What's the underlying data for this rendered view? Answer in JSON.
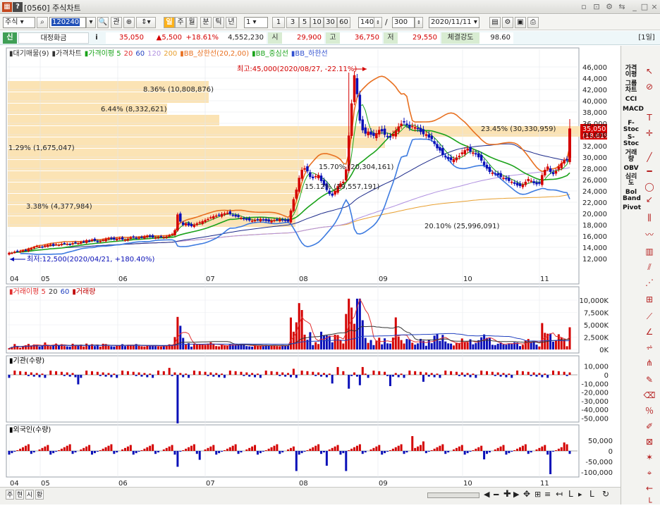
{
  "window": {
    "code": "[0560]",
    "title": "주식차트",
    "help": "?"
  },
  "toolbar": {
    "market": "주식",
    "stock_code": "120240",
    "b_gwan": "관",
    "periods": [
      "일",
      "주",
      "월",
      "분",
      "틱",
      "년"
    ],
    "interval": "1",
    "minutes": [
      "1",
      "3",
      "5",
      "10",
      "30",
      "60"
    ],
    "count": "140",
    "slash": "/",
    "total": "300",
    "date": "2020/11/11"
  },
  "quote": {
    "badge": "신",
    "name": "대정화금",
    "info": "i",
    "price": "35,050",
    "change": "▲5,500",
    "rate": "+18.61%",
    "volume": "4,552,230",
    "open_label": "시",
    "open": "29,900",
    "high_label": "고",
    "high": "36,750",
    "low_label": "저",
    "low": "29,550",
    "strength_label": "체결강도",
    "strength": "98.60",
    "period": "[1일]"
  },
  "price_panel": {
    "legend": [
      {
        "text": "대기매물(9)",
        "color": "#333333"
      },
      {
        "text": "가격차트",
        "color": "#333333"
      },
      {
        "text": "가격이평 5",
        "color": "#1aa31a"
      },
      {
        "text": "20",
        "color": "#e23030"
      },
      {
        "text": "60",
        "color": "#2040c0"
      },
      {
        "text": "120",
        "color": "#b090e0"
      },
      {
        "text": "200",
        "color": "#e8a030"
      },
      {
        "text": "BB_상한선(20,2,00)",
        "color": "#e87020"
      },
      {
        "text": "BB_중심선",
        "color": "#1aa31a"
      },
      {
        "text": "BB_하한선",
        "color": "#3050d0"
      }
    ],
    "volume_profile": [
      {
        "text": "8.36% (10,808,876)"
      },
      {
        "text": "6.44% (8,332,621)"
      },
      {
        "text": "1.29% (1,675,047)"
      },
      {
        "text": "23.45% (30,330,959)"
      },
      {
        "text": "15.70% (20,304,161)"
      },
      {
        "text": "15.12% (19,557,191)"
      },
      {
        "text": "3.38% (4,377,984)"
      },
      {
        "text": "20.10% (25,996,091)"
      }
    ],
    "high_marker": "최고:45,000(2020/08/27, -22.11%)",
    "low_marker": "최저:12,500(2020/04/21, +180.40%)",
    "last_price": "35,050",
    "last_rate": "(18.61%)",
    "y_ticks": [
      "46,000",
      "44,000",
      "42,000",
      "40,000",
      "38,000",
      "36,000",
      "34,000",
      "32,000",
      "30,000",
      "28,000",
      "26,000",
      "24,000",
      "22,000",
      "20,000",
      "18,000",
      "16,000",
      "14,000",
      "12,000"
    ]
  },
  "volume_panel": {
    "legend": [
      {
        "text": "거래이평 5",
        "color": "#e23030"
      },
      {
        "text": "20",
        "color": "#333333"
      },
      {
        "text": "60",
        "color": "#2040c0"
      },
      {
        "text": "거래량",
        "color": "#c00000"
      }
    ],
    "y_ticks": [
      "10,000K",
      "7,500K",
      "5,000K",
      "2,500K",
      "0K"
    ]
  },
  "inst_panel": {
    "legend": "기관(수량)",
    "y_ticks": [
      "10,000",
      "0",
      "-10,000",
      "-20,000",
      "-30,000",
      "-40,000",
      "-50,000"
    ]
  },
  "foreign_panel": {
    "legend": "외국인(수량)",
    "y_ticks": [
      "50,000",
      "0",
      "-50,000",
      "-100,000"
    ]
  },
  "x_axis": [
    "04",
    "05",
    "06",
    "07",
    "08",
    "09",
    "10",
    "11"
  ],
  "bottom": {
    "tabs": [
      "주",
      "현",
      "시",
      "황"
    ]
  },
  "sidebar": {
    "buttons": [
      "가격이평",
      "그룹차트",
      "CCI",
      "MACD",
      "F-Stoc",
      "S-Stoc",
      "거래량",
      "OBV",
      "심리도",
      "Bol Band",
      "Pivot"
    ]
  },
  "colors": {
    "up": "#d40000",
    "down": "#0a10b8",
    "profile": "#fbe3b4"
  }
}
